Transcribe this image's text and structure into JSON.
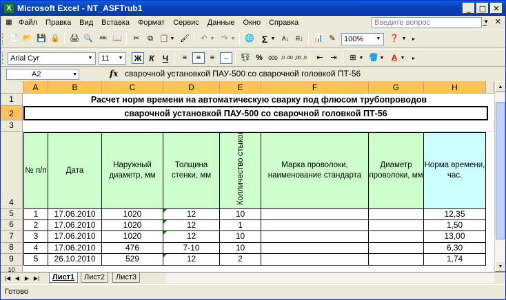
{
  "window": {
    "title": "Microsoft Excel - NT_ASFTrub1",
    "app_icon": "X"
  },
  "menu": {
    "items": [
      "Файл",
      "Правка",
      "Вид",
      "Вставка",
      "Формат",
      "Сервис",
      "Данные",
      "Окно",
      "Справка"
    ],
    "help_placeholder": "Введите вопрос"
  },
  "toolbar": {
    "font_name": "Arial Cyr",
    "font_size": "11",
    "zoom": "100%",
    "bold": "Ж",
    "italic": "К",
    "underline": "Ч",
    "sigma": "Σ",
    "percent": "%",
    "thousands": "000",
    "inc_dec": ",0 .00",
    "dec_dec": ",00 ,0"
  },
  "formula_bar": {
    "name_box": "A2",
    "fx": "fx",
    "content": "сварочной установкой ПАУ-500 со сварочной головкой ПТ-56"
  },
  "sheet": {
    "columns": [
      "A",
      "B",
      "C",
      "D",
      "E",
      "F",
      "G",
      "H"
    ],
    "rows": [
      "1",
      "2",
      "3",
      "4",
      "5",
      "6",
      "7",
      "8",
      "9",
      "10"
    ],
    "title1": "Расчет норм времени на автоматическую сварку под флюсом трубопроводов",
    "title2": "сварочной установкой ПАУ-500 со сварочной головкой ПТ-56",
    "headers": {
      "num": "№ п/п",
      "date": "Дата",
      "diameter": "Наружный диаметр, мм",
      "thickness": "Толщина стенки, мм",
      "count": "Колличество стыков, шт",
      "wire_brand": "Марка проволоки, наименование стандарта",
      "wire_diameter": "Диаметр проволоки, мм",
      "norm": "Норма времени, час."
    },
    "data": [
      {
        "num": "1",
        "date": "17.06.2010",
        "diameter": "1020",
        "thickness": "12",
        "count": "10",
        "wire_brand": "",
        "wire_diameter": "",
        "norm": "12,35"
      },
      {
        "num": "2",
        "date": "17.06.2010",
        "diameter": "1020",
        "thickness": "12",
        "count": "1",
        "wire_brand": "",
        "wire_diameter": "",
        "norm": "1,50"
      },
      {
        "num": "3",
        "date": "17.06.2010",
        "diameter": "1020",
        "thickness": "12",
        "count": "10",
        "wire_brand": "",
        "wire_diameter": "",
        "norm": "13,00"
      },
      {
        "num": "4",
        "date": "17.06.2010",
        "diameter": "476",
        "thickness": "7-10",
        "count": "10",
        "wire_brand": "",
        "wire_diameter": "",
        "norm": "6,30"
      },
      {
        "num": "5",
        "date": "26.10.2010",
        "diameter": "529",
        "thickness": "12",
        "count": "2",
        "wire_brand": "",
        "wire_diameter": "",
        "norm": "1,74"
      }
    ]
  },
  "tabs": [
    "Лист1",
    "Лист2",
    "Лист3"
  ],
  "status": "Готово"
}
